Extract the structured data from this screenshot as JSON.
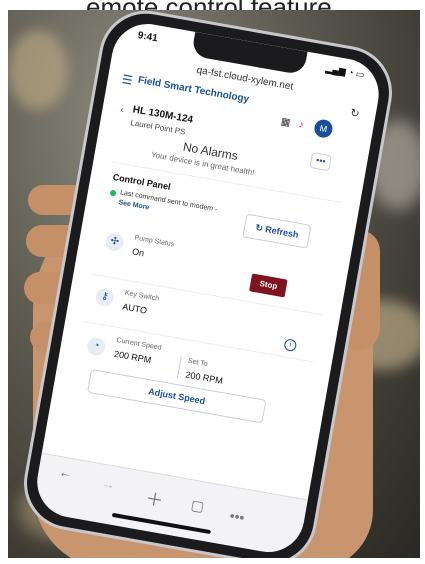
{
  "caption": "emote control feature.",
  "status": {
    "time": "9:41"
  },
  "browser": {
    "url": "qa-fst.cloud-xylem.net"
  },
  "app": {
    "brand": "Field Smart Technology",
    "avatar": "M"
  },
  "site": {
    "title": "HL 130M-124",
    "subtitle": "Laurel Point PS"
  },
  "alarms": {
    "title": "No Alarms",
    "subtitle": "Your device is in great health!"
  },
  "control_panel": {
    "title": "Control Panel",
    "last_command": "Last command sent to modem -",
    "see_more": "See More",
    "refresh": "Refresh",
    "pump_status_label": "Pump Status",
    "pump_status_value": "On",
    "stop": "Stop",
    "key_switch_label": "Key Switch",
    "key_switch_value": "AUTO",
    "current_speed_label": "Current Speed",
    "current_speed_value": "200 RPM",
    "set_to_label": "Set To",
    "set_to_value": "200 RPM",
    "adjust_speed": "Adjust Speed"
  },
  "colors": {
    "accent": "#1b4f9c",
    "stop": "#7d1420",
    "status_ok": "#1fbd4b"
  },
  "icons": [
    "menu-icon",
    "grid-icon",
    "bell-icon",
    "fan-icon",
    "key-icon",
    "gauge-icon",
    "info-icon",
    "refresh-icon",
    "back-icon",
    "forward-icon",
    "plus-icon",
    "tabs-icon",
    "more-icon"
  ]
}
